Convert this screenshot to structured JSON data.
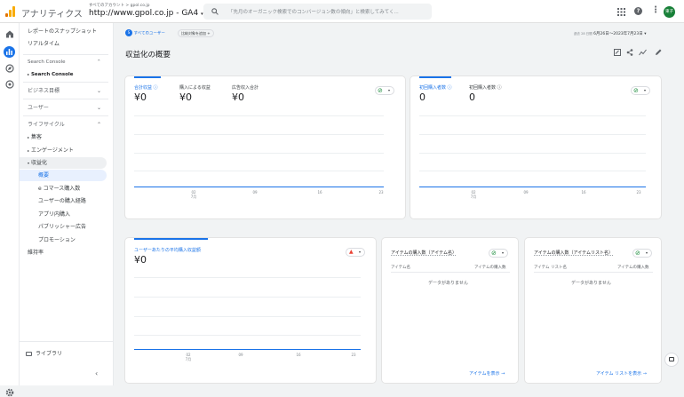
{
  "header": {
    "app_name": "アナリティクス",
    "breadcrumb": "すべてのアカウント > gpol.co.jp",
    "property": "http://www.gpol.co.jp - GA4",
    "search_placeholder": "「先月のオーガニック検索でのコンバージョン数の傾向」と検索してみてく...",
    "avatar": "東子"
  },
  "sidebar": {
    "items": [
      {
        "label": "レポートのスナップショット"
      },
      {
        "label": "リアルタイム"
      },
      {
        "label": "Search Console"
      },
      {
        "label": "Search Console"
      },
      {
        "label": "ビジネス目標"
      },
      {
        "label": "ユーザー"
      },
      {
        "label": "ライフサイクル"
      },
      {
        "label": "集客"
      },
      {
        "label": "エンゲージメント"
      },
      {
        "label": "収益化"
      },
      {
        "label": "概要"
      },
      {
        "label": "e コマース購入数"
      },
      {
        "label": "ユーザーの購入経路"
      },
      {
        "label": "アプリ内購入"
      },
      {
        "label": "パブリッシャー広告"
      },
      {
        "label": "プロモーション"
      },
      {
        "label": "維持率"
      }
    ],
    "library": "ライブラリ"
  },
  "toolbar": {
    "segment": "すべてのユーザー",
    "compare": "比較対象を追加 +",
    "date_prefix": "過去 28 日間",
    "date_range": "6月26日～2023年7月23日"
  },
  "page": {
    "title": "収益化の概要"
  },
  "card1": {
    "metrics": [
      {
        "label": "合計収益",
        "value": "¥0"
      },
      {
        "label": "購入による収益",
        "value": "¥0"
      },
      {
        "label": "広告収入合計",
        "value": "¥0"
      }
    ],
    "ticks": [
      {
        "day": "02",
        "month": "7月"
      },
      {
        "day": "09"
      },
      {
        "day": "16"
      },
      {
        "day": "23"
      }
    ]
  },
  "card2": {
    "metrics": [
      {
        "label": "初回購入者数",
        "value": "0"
      },
      {
        "label": "初回購入者数",
        "value": "0"
      }
    ],
    "ticks": [
      {
        "day": "02",
        "month": "7月"
      },
      {
        "day": "09"
      },
      {
        "day": "16"
      },
      {
        "day": "23"
      }
    ]
  },
  "card3": {
    "label": "ユーザーあたりの平均購入収益額",
    "value": "¥0",
    "ticks": [
      {
        "day": "02",
        "month": "7月"
      },
      {
        "day": "09"
      },
      {
        "day": "16"
      },
      {
        "day": "23"
      }
    ]
  },
  "card4": {
    "title": "アイテムの購入数（アイテム名）",
    "col1": "アイテム名",
    "col2": "アイテムの購入数",
    "empty": "データがありません",
    "link": "アイテムを表示"
  },
  "card5": {
    "title": "アイテムの購入数（アイテムリスト名）",
    "col1": "アイテム リスト名",
    "col2": "アイテムの購入数",
    "empty": "データがありません",
    "link": "アイテム リストを表示"
  },
  "colors": {
    "accent": "#1a73e8",
    "logo_orange": "#f9ab00",
    "logo_dark": "#e37400",
    "success": "#1e8e3e",
    "warning": "#ea4335",
    "avatar": "#188038"
  }
}
